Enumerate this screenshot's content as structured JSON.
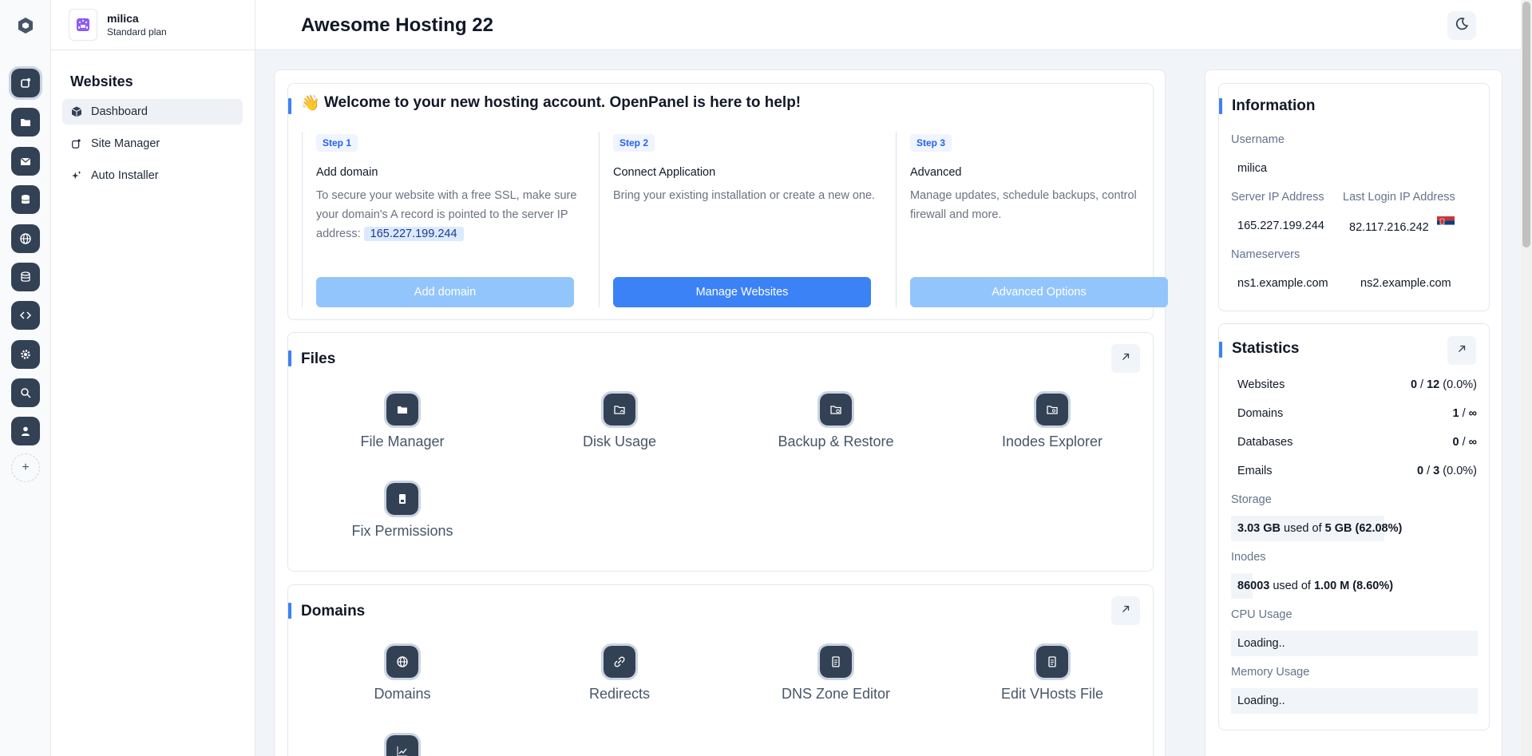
{
  "header": {
    "title": "Awesome Hosting 22"
  },
  "profile": {
    "username": "milica",
    "plan": "Standard plan"
  },
  "sidebar": {
    "heading": "Websites",
    "items": [
      {
        "label": "Dashboard",
        "icon": "cube-icon"
      },
      {
        "label": "Site Manager",
        "icon": "external-square-icon"
      },
      {
        "label": "Auto Installer",
        "icon": "sparkle-icon"
      }
    ]
  },
  "rail": {
    "icons": [
      "site-icon",
      "folder-icon",
      "mail-icon",
      "database-icon",
      "globe-icon",
      "server-icon",
      "code-icon",
      "gear-icon",
      "search-icon",
      "user-icon",
      "plus-icon"
    ]
  },
  "welcome": {
    "emoji": "👋",
    "title": "Welcome to your new hosting account. OpenPanel is here to help!",
    "steps": [
      {
        "badge": "Step 1",
        "title": "Add domain",
        "text": "To secure your website with a free SSL, make sure your domain's A record is pointed to the server IP address:",
        "ip": "165.227.199.244",
        "button": "Add domain"
      },
      {
        "badge": "Step 2",
        "title": "Connect Application",
        "text": "Bring your existing installation or create a new one.",
        "button": "Manage Websites"
      },
      {
        "badge": "Step 3",
        "title": "Advanced",
        "text": "Manage updates, schedule backups, control firewall and more.",
        "button": "Advanced Options"
      }
    ]
  },
  "files": {
    "title": "Files",
    "tiles": [
      "File Manager",
      "Disk Usage",
      "Backup & Restore",
      "Inodes Explorer",
      "Fix Permissions"
    ]
  },
  "domains": {
    "title": "Domains",
    "tiles": [
      "Domains",
      "Redirects",
      "DNS Zone Editor",
      "Edit VHosts File"
    ]
  },
  "information": {
    "title": "Information",
    "username_label": "Username",
    "username": "milica",
    "server_ip_label": "Server IP Address",
    "server_ip": "165.227.199.244",
    "last_login_label": "Last Login IP Address",
    "last_login_ip": "82.117.216.242",
    "nameservers_label": "Nameservers",
    "ns1": "ns1.example.com",
    "ns2": "ns2.example.com"
  },
  "statistics": {
    "title": "Statistics",
    "rows": [
      {
        "label": "Websites",
        "used": "0",
        "sep": " / ",
        "total": "12",
        "pct": " (0.0%)"
      },
      {
        "label": "Domains",
        "used": "1",
        "sep": " / ",
        "total": "∞",
        "pct": ""
      },
      {
        "label": "Databases",
        "used": "0",
        "sep": " / ",
        "total": "∞",
        "pct": ""
      },
      {
        "label": "Emails",
        "used": "0",
        "sep": " / ",
        "total": "3",
        "pct": " (0.0%)"
      }
    ],
    "storage_label": "Storage",
    "storage_used": "3.03 GB",
    "storage_mid": " used of ",
    "storage_total": "5 GB (62.08%)",
    "storage_fraction": 0.6208,
    "inodes_label": "Inodes",
    "inodes_used": "86003",
    "inodes_mid": " used of ",
    "inodes_total": "1.00 M (8.60%)",
    "inodes_fraction": 0.086,
    "cpu_label": "CPU Usage",
    "cpu_value": "Loading..",
    "memory_label": "Memory Usage",
    "memory_value": "Loading.."
  },
  "colors": {
    "accent": "#3b82f6",
    "accent_light": "#93c5fd",
    "rail_button": "#334155"
  }
}
